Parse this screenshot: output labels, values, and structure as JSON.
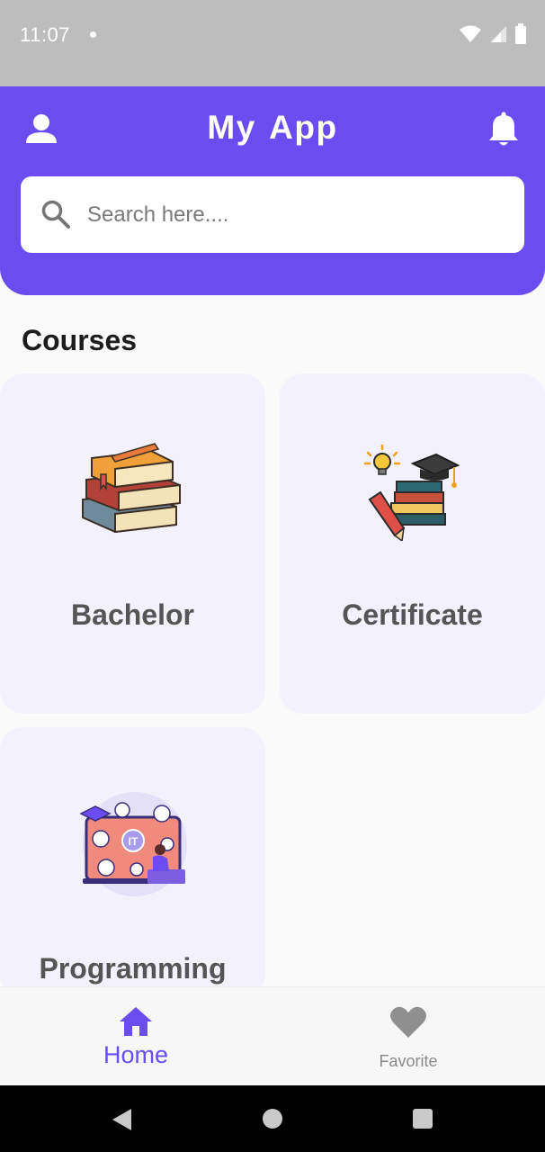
{
  "status_bar": {
    "time": "11:07"
  },
  "header": {
    "title": "My App",
    "search_placeholder": "Search here...."
  },
  "content": {
    "section_title": "Courses",
    "courses": [
      {
        "label": "Bachelor",
        "icon": "stacked-books-icon"
      },
      {
        "label": "Certificate",
        "icon": "graduation-books-icon"
      },
      {
        "label": "Programming",
        "icon": "programming-laptop-icon"
      }
    ]
  },
  "bottom_nav": {
    "items": [
      {
        "label": "Home",
        "icon": "home-icon",
        "active": true
      },
      {
        "label": "Favorite",
        "icon": "heart-icon",
        "active": false
      }
    ]
  },
  "colors": {
    "accent": "#6a4cf0",
    "card_bg": "#f3f1fc",
    "status_bar": "#bdbdbd"
  }
}
